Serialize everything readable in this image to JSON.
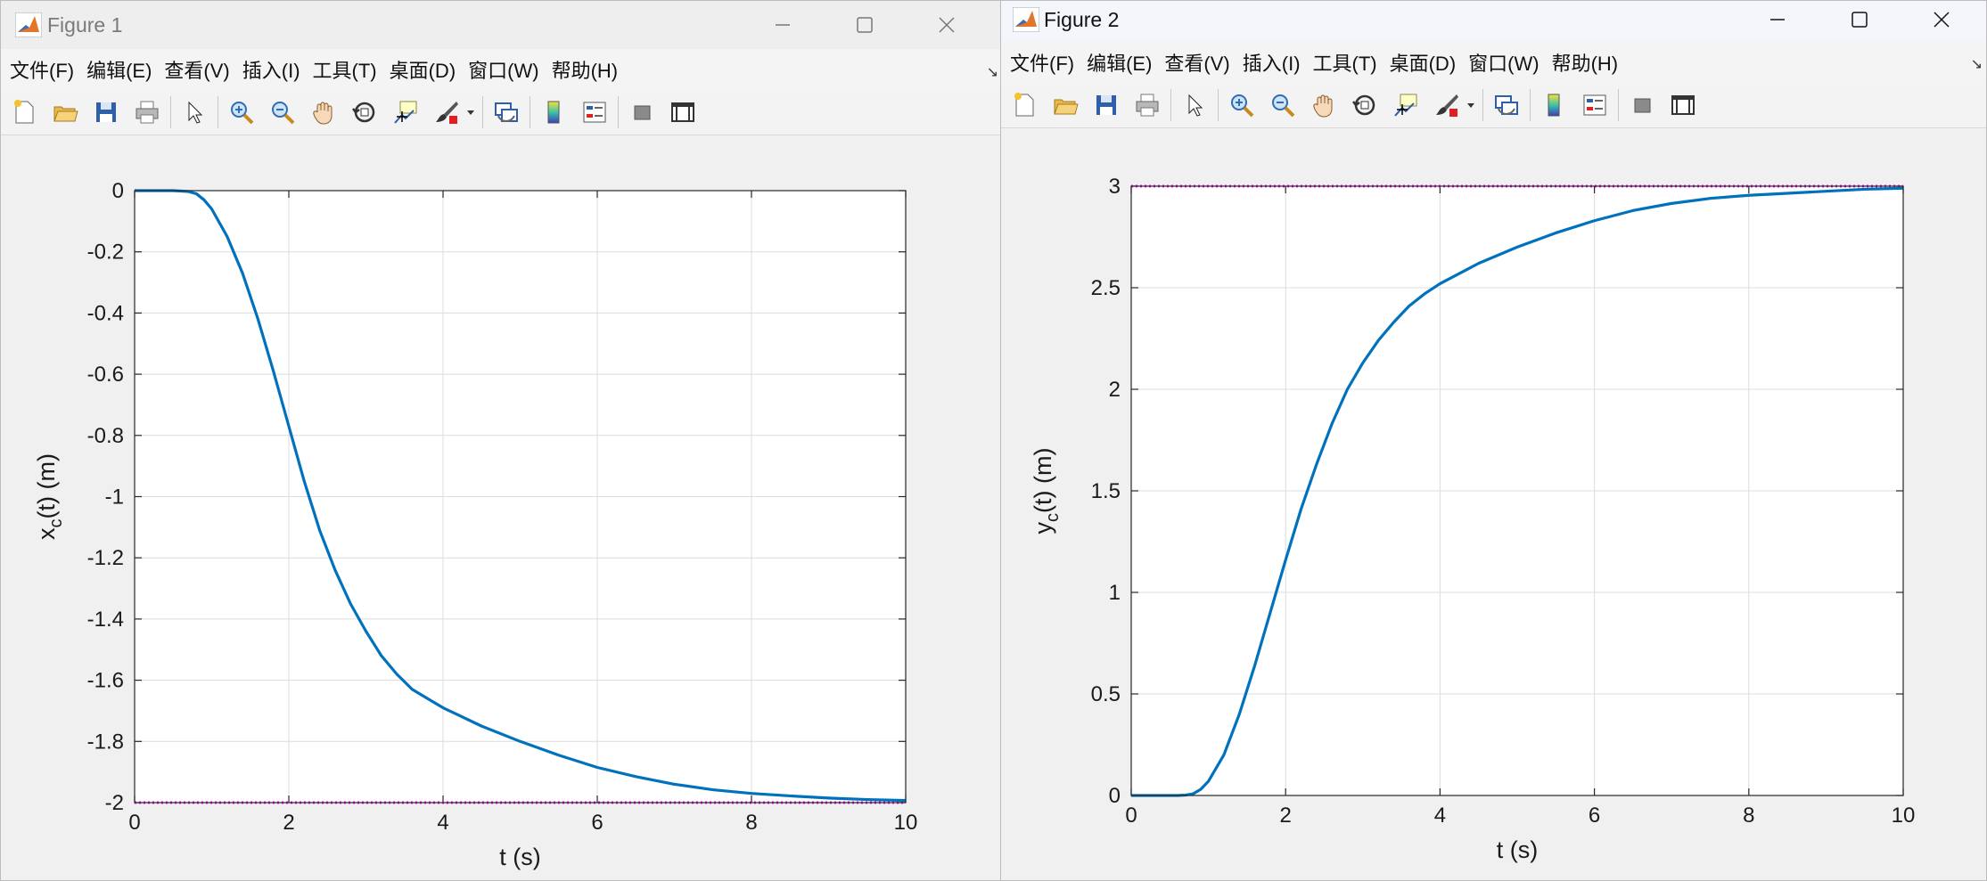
{
  "figure1": {
    "title": "Figure 1",
    "menu": [
      "文件(F)",
      "编辑(E)",
      "查看(V)",
      "插入(I)",
      "工具(T)",
      "桌面(D)",
      "窗口(W)",
      "帮助(H)"
    ],
    "menu_overflow": "↘"
  },
  "figure2": {
    "title": "Figure 2",
    "menu": [
      "文件(F)",
      "编辑(E)",
      "查看(V)",
      "插入(I)",
      "工具(T)",
      "桌面(D)",
      "窗口(W)",
      "帮助(H)"
    ],
    "menu_overflow": "↘"
  },
  "toolbar_icons": [
    "new-figure-icon",
    "open-file-icon",
    "save-icon",
    "print-icon",
    "pointer-icon",
    "zoom-in-icon",
    "zoom-out-icon",
    "pan-hand-icon",
    "rotate-3d-icon",
    "data-cursor-icon",
    "brush-icon",
    "link-plot-icon",
    "colorbar-icon",
    "legend-icon",
    "hide-plot-tools-icon",
    "show-plot-tools-icon"
  ],
  "colors": {
    "line": "#0072bd",
    "reference": "#ff00ff",
    "grid": "#dcdcdc"
  },
  "chart_data": [
    {
      "type": "line",
      "xlabel": "t (s)",
      "ylabel": "x_c(t) (m)",
      "xlim": [
        0,
        10
      ],
      "ylim": [
        -2,
        0
      ],
      "xticks": [
        "0",
        "2",
        "4",
        "6",
        "8",
        "10"
      ],
      "yticks": [
        "0",
        "-0.2",
        "-0.4",
        "-0.6",
        "-0.8",
        "-1",
        "-1.2",
        "-1.4",
        "-1.6",
        "-1.8",
        "-2"
      ],
      "grid": true,
      "series": [
        {
          "x": [
            0,
            0.5,
            0.7,
            0.8,
            0.9,
            1.0,
            1.2,
            1.4,
            1.6,
            1.8,
            2.0,
            2.2,
            2.4,
            2.6,
            2.8,
            3.0,
            3.2,
            3.4,
            3.6,
            3.8,
            4.0,
            4.5,
            5.0,
            5.5,
            6.0,
            6.5,
            7.0,
            7.5,
            8.0,
            8.5,
            9.0,
            9.5,
            10.0
          ],
          "y": [
            0,
            0,
            -0.003,
            -0.01,
            -0.03,
            -0.06,
            -0.15,
            -0.27,
            -0.42,
            -0.59,
            -0.77,
            -0.95,
            -1.11,
            -1.24,
            -1.35,
            -1.44,
            -1.52,
            -1.58,
            -1.63,
            -1.66,
            -1.69,
            -1.75,
            -1.8,
            -1.845,
            -1.885,
            -1.915,
            -1.94,
            -1.958,
            -1.97,
            -1.978,
            -1.985,
            -1.99,
            -1.993
          ]
        },
        {
          "x": [
            0,
            10
          ],
          "y": [
            -2,
            -2
          ]
        }
      ]
    },
    {
      "type": "line",
      "xlabel": "t (s)",
      "ylabel": "y_c(t) (m)",
      "xlim": [
        0,
        10
      ],
      "ylim": [
        0,
        3
      ],
      "xticks": [
        "0",
        "2",
        "4",
        "6",
        "8",
        "10"
      ],
      "yticks": [
        "0",
        "0.5",
        "1",
        "1.5",
        "2",
        "2.5",
        "3"
      ],
      "grid": true,
      "series": [
        {
          "x": [
            0,
            0.6,
            0.7,
            0.8,
            0.9,
            1.0,
            1.2,
            1.4,
            1.6,
            1.8,
            2.0,
            2.2,
            2.4,
            2.6,
            2.8,
            3.0,
            3.2,
            3.4,
            3.6,
            3.8,
            4.0,
            4.5,
            5.0,
            5.5,
            6.0,
            6.5,
            7.0,
            7.5,
            8.0,
            8.5,
            9.0,
            9.5,
            10.0
          ],
          "y": [
            0,
            0,
            0.002,
            0.008,
            0.03,
            0.07,
            0.2,
            0.4,
            0.64,
            0.9,
            1.16,
            1.41,
            1.63,
            1.83,
            2.0,
            2.13,
            2.24,
            2.33,
            2.41,
            2.47,
            2.52,
            2.62,
            2.7,
            2.77,
            2.83,
            2.88,
            2.915,
            2.94,
            2.955,
            2.965,
            2.975,
            2.985,
            2.99
          ]
        },
        {
          "x": [
            0,
            10
          ],
          "y": [
            3,
            3
          ]
        }
      ]
    }
  ]
}
